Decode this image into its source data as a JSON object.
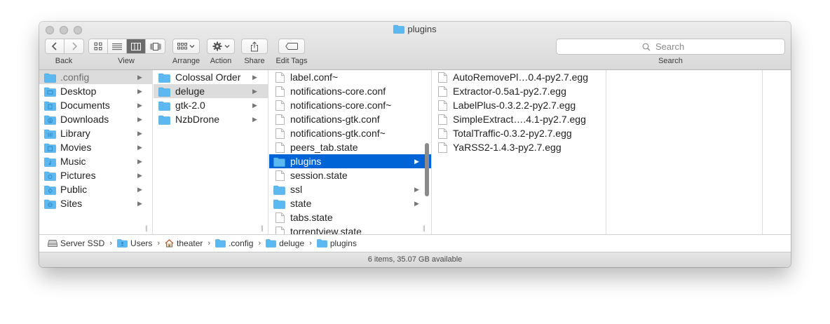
{
  "window": {
    "title": "plugins"
  },
  "toolbar": {
    "back_label": "Back",
    "view_label": "View",
    "arrange_label": "Arrange",
    "action_label": "Action",
    "share_label": "Share",
    "edit_tags_label": "Edit Tags",
    "search_label": "Search",
    "search_placeholder": "Search",
    "view_modes": [
      "icon-view",
      "list-view",
      "column-view",
      "cover-flow-view"
    ],
    "active_view": "column-view"
  },
  "colors": {
    "folder": "#5bb8f0",
    "selection_blue": "#0063d6",
    "selection_gray": "#dcdcdc"
  },
  "sidebar": {
    "items": [
      {
        "label": ".config",
        "icon": "folder-icon",
        "selected": true
      },
      {
        "label": "Desktop",
        "icon": "desktop-folder-icon"
      },
      {
        "label": "Documents",
        "icon": "documents-folder-icon"
      },
      {
        "label": "Downloads",
        "icon": "downloads-folder-icon"
      },
      {
        "label": "Library",
        "icon": "library-folder-icon"
      },
      {
        "label": "Movies",
        "icon": "movies-folder-icon"
      },
      {
        "label": "Music",
        "icon": "music-folder-icon"
      },
      {
        "label": "Pictures",
        "icon": "pictures-folder-icon"
      },
      {
        "label": "Public",
        "icon": "public-folder-icon"
      },
      {
        "label": "Sites",
        "icon": "sites-folder-icon"
      }
    ]
  },
  "col2": {
    "items": [
      {
        "label": "Colossal Order"
      },
      {
        "label": "deluge",
        "selected": true
      },
      {
        "label": "gtk-2.0"
      },
      {
        "label": "NzbDrone"
      }
    ]
  },
  "col3": {
    "items": [
      {
        "label": "label.conf~",
        "type": "file"
      },
      {
        "label": "notifications-core.conf",
        "type": "file"
      },
      {
        "label": "notifications-core.conf~",
        "type": "file"
      },
      {
        "label": "notifications-gtk.conf",
        "type": "file"
      },
      {
        "label": "notifications-gtk.conf~",
        "type": "file"
      },
      {
        "label": "peers_tab.state",
        "type": "file"
      },
      {
        "label": "plugins",
        "type": "folder",
        "selected": true
      },
      {
        "label": "session.state",
        "type": "file"
      },
      {
        "label": "ssl",
        "type": "folder"
      },
      {
        "label": "state",
        "type": "folder"
      },
      {
        "label": "tabs.state",
        "type": "file"
      },
      {
        "label": "torrentview.state",
        "type": "file"
      }
    ]
  },
  "col4": {
    "items": [
      {
        "label": "AutoRemovePl…0.4-py2.7.egg"
      },
      {
        "label": "Extractor-0.5a1-py2.7.egg"
      },
      {
        "label": "LabelPlus-0.3.2.2-py2.7.egg"
      },
      {
        "label": "SimpleExtract….4.1-py2.7.egg"
      },
      {
        "label": "TotalTraffic-0.3.2-py2.7.egg"
      },
      {
        "label": "YaRSS2-1.4.3-py2.7.egg"
      }
    ]
  },
  "pathbar": {
    "crumbs": [
      {
        "label": "Server SSD",
        "icon": "hard-drive-icon"
      },
      {
        "label": "Users",
        "icon": "users-folder-icon"
      },
      {
        "label": "theater",
        "icon": "home-icon"
      },
      {
        "label": ".config",
        "icon": "folder-icon"
      },
      {
        "label": "deluge",
        "icon": "folder-icon"
      },
      {
        "label": "plugins",
        "icon": "folder-icon"
      }
    ]
  },
  "status": {
    "text": "6 items, 35.07 GB available"
  }
}
